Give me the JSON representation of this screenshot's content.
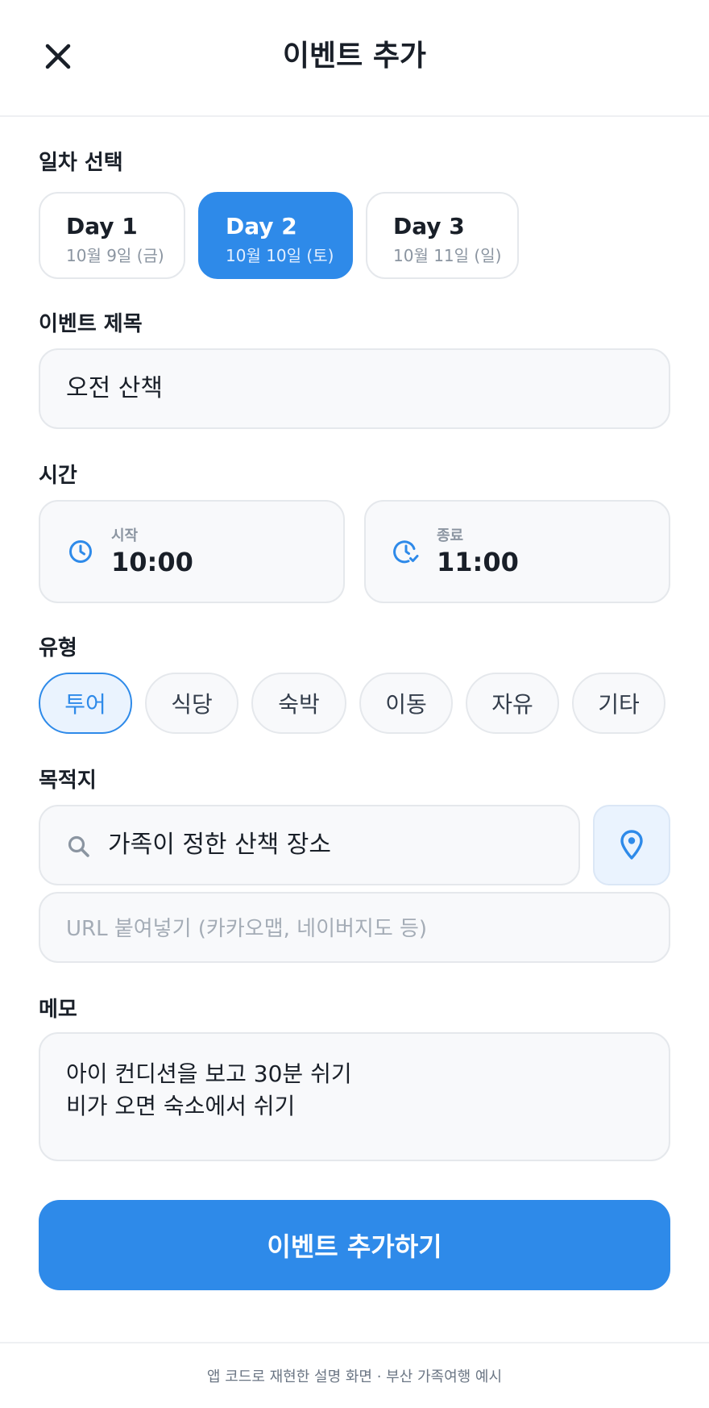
{
  "header": {
    "title": "이벤트 추가"
  },
  "day_section": {
    "label": "일차 선택",
    "days": [
      {
        "title": "Day 1",
        "date": "10월 9일 (금)"
      },
      {
        "title": "Day 2",
        "date": "10월 10일 (토)",
        "selected": true
      },
      {
        "title": "Day 3",
        "date": "10월 11일 (일)"
      }
    ]
  },
  "event_title": {
    "label": "이벤트 제목",
    "value": "오전 산책"
  },
  "time": {
    "label": "시간",
    "start": {
      "label": "시작",
      "value": "10:00"
    },
    "end": {
      "label": "종료",
      "value": "11:00"
    }
  },
  "type": {
    "label": "유형",
    "options": [
      "투어",
      "식당",
      "숙박",
      "이동",
      "자유",
      "기타"
    ],
    "selected": "투어"
  },
  "destination": {
    "label": "목적지",
    "search_value": "가족이 정한 산책 장소",
    "url_placeholder": "URL 붙여넣기 (카카오맵, 네이버지도 등)"
  },
  "memo": {
    "label": "메모",
    "line1": "아이 컨디션을 보고 30분 쉬기",
    "line2": "비가 오면 숙소에서 쉬기"
  },
  "submit_label": "이벤트 추가하기",
  "footer_text": "앱 코드로 재현한 설명 화면 · 부산 가족여행 예시",
  "colors": {
    "accent": "#2e8ae9",
    "accent_light": "#eaf3fe",
    "field_bg": "#f8f9fb",
    "border": "#e5e8ec",
    "text": "#191f28",
    "muted": "#8b95a1"
  }
}
